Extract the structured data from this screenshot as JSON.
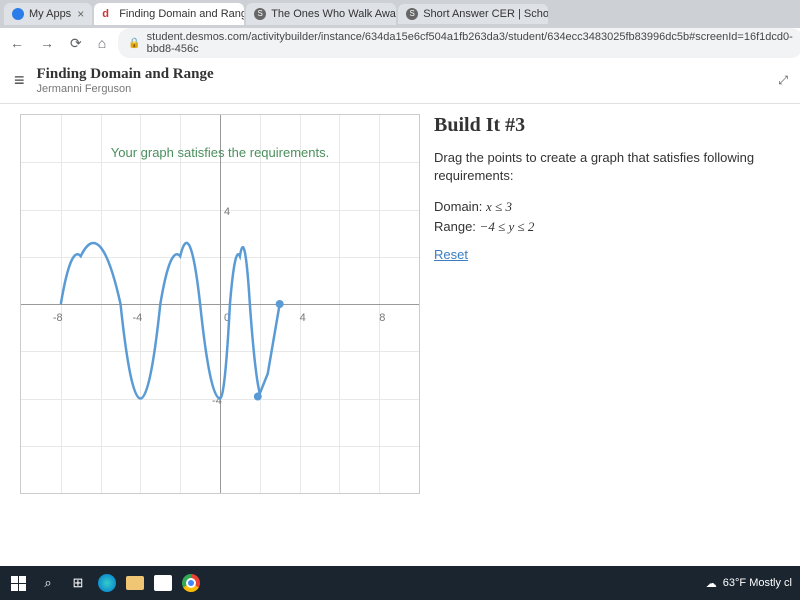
{
  "tabs": [
    {
      "label": "My Apps",
      "icon_color": "#2b7de9"
    },
    {
      "label": "Finding Domain and Range",
      "icon_text": "d"
    },
    {
      "label": "The Ones Who Walk Away Fr",
      "icon_bg": "#666"
    },
    {
      "label": "Short Answer CER | Schoolo",
      "icon_bg": "#666"
    }
  ],
  "url": "student.desmos.com/activitybuilder/instance/634da15e6cf504a1fb263da3/student/634ecc3483025fb83996dc5b#screenId=16f1dcd0-bbd8-456c",
  "header": {
    "title": "Finding Domain and Range",
    "subtitle": "Jermanni Ferguson"
  },
  "graph": {
    "message": "Your graph satisfies the requirements.",
    "x_ticks": {
      "neg8": "-8",
      "neg4": "-4",
      "zero": "0",
      "pos4": "4",
      "pos8": "8"
    },
    "y_ticks": {
      "pos4": "4",
      "neg4": "-4"
    }
  },
  "side": {
    "title": "Build It #3",
    "instruction": "Drag the points to create a graph that satisfies following requirements:",
    "domain_label": "Domain:",
    "domain_expr": "x ≤ 3",
    "range_label": "Range:",
    "range_expr": "−4 ≤ y ≤ 2",
    "reset": "Reset"
  },
  "taskbar": {
    "weather": "63°F Mostly cl"
  },
  "chart_data": {
    "type": "line",
    "title": "",
    "xlabel": "",
    "ylabel": "",
    "xlim": [
      -10,
      10
    ],
    "ylim": [
      -8,
      8
    ],
    "x_ticks": [
      -8,
      -4,
      0,
      4,
      8
    ],
    "y_ticks": [
      -4,
      4
    ],
    "message": "Your graph satisfies the requirements.",
    "series": [
      {
        "name": "curve",
        "color": "#5b9bd5",
        "points": [
          {
            "x": -8,
            "y": 0
          },
          {
            "x": -7,
            "y": 2
          },
          {
            "x": -6,
            "y": 0
          },
          {
            "x": -5,
            "y": -4
          },
          {
            "x": -4,
            "y": 0
          },
          {
            "x": -3,
            "y": 2
          },
          {
            "x": -2,
            "y": 0
          },
          {
            "x": -1,
            "y": -4
          },
          {
            "x": 0,
            "y": 0
          },
          {
            "x": 0.5,
            "y": 2
          },
          {
            "x": 1,
            "y": 0
          },
          {
            "x": 1.5,
            "y": -4
          },
          {
            "x": 2,
            "y": -2
          },
          {
            "x": 3,
            "y": 0
          }
        ],
        "endpoints": [
          {
            "x": 1.5,
            "y": -4,
            "filled": true
          },
          {
            "x": 3,
            "y": 0,
            "filled": true
          }
        ]
      }
    ]
  }
}
